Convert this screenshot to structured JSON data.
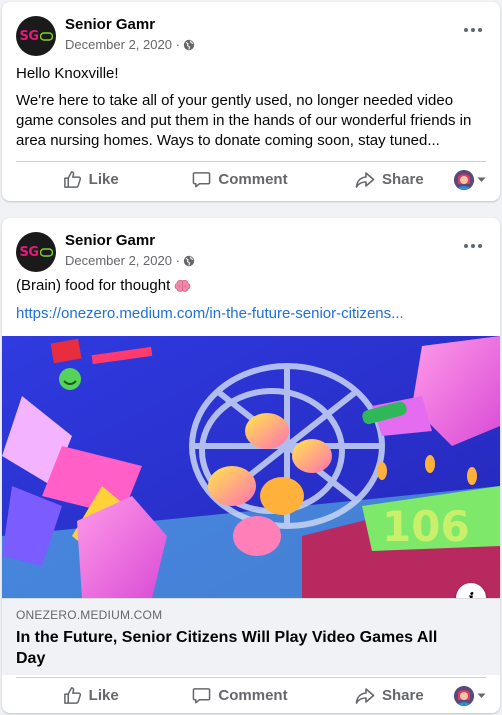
{
  "posts": [
    {
      "author": "Senior Gamr",
      "avatar_text": "SG",
      "date": "December 2, 2020 ·",
      "hello": "Hello Knoxville!",
      "body": "We're here to take all of your gently used, no longer needed video game consoles and put them in the hands of our wonderful friends in area nursing homes. Ways to donate coming soon, stay tuned...",
      "actions": {
        "like": "Like",
        "comment": "Comment",
        "share": "Share"
      }
    },
    {
      "author": "Senior Gamr",
      "avatar_text": "SG",
      "date": "December 2, 2020 ·",
      "text": "(Brain) food for thought",
      "link": "https://onezero.medium.com/in-the-future-senior-citizens...",
      "preview": {
        "domain": "ONEZERO.MEDIUM.COM",
        "headline": "In the Future, Senior Citizens Will Play Video Games All Day"
      },
      "actions": {
        "like": "Like",
        "comment": "Comment",
        "share": "Share"
      }
    }
  ],
  "colors": {
    "accent": "#216fdb",
    "muted": "#65676b",
    "brand_pink": "#e8197d"
  },
  "icons": [
    "globe-icon",
    "more-icon",
    "like-icon",
    "comment-icon",
    "share-icon",
    "brain-icon",
    "info-icon",
    "chevron-down-icon"
  ]
}
